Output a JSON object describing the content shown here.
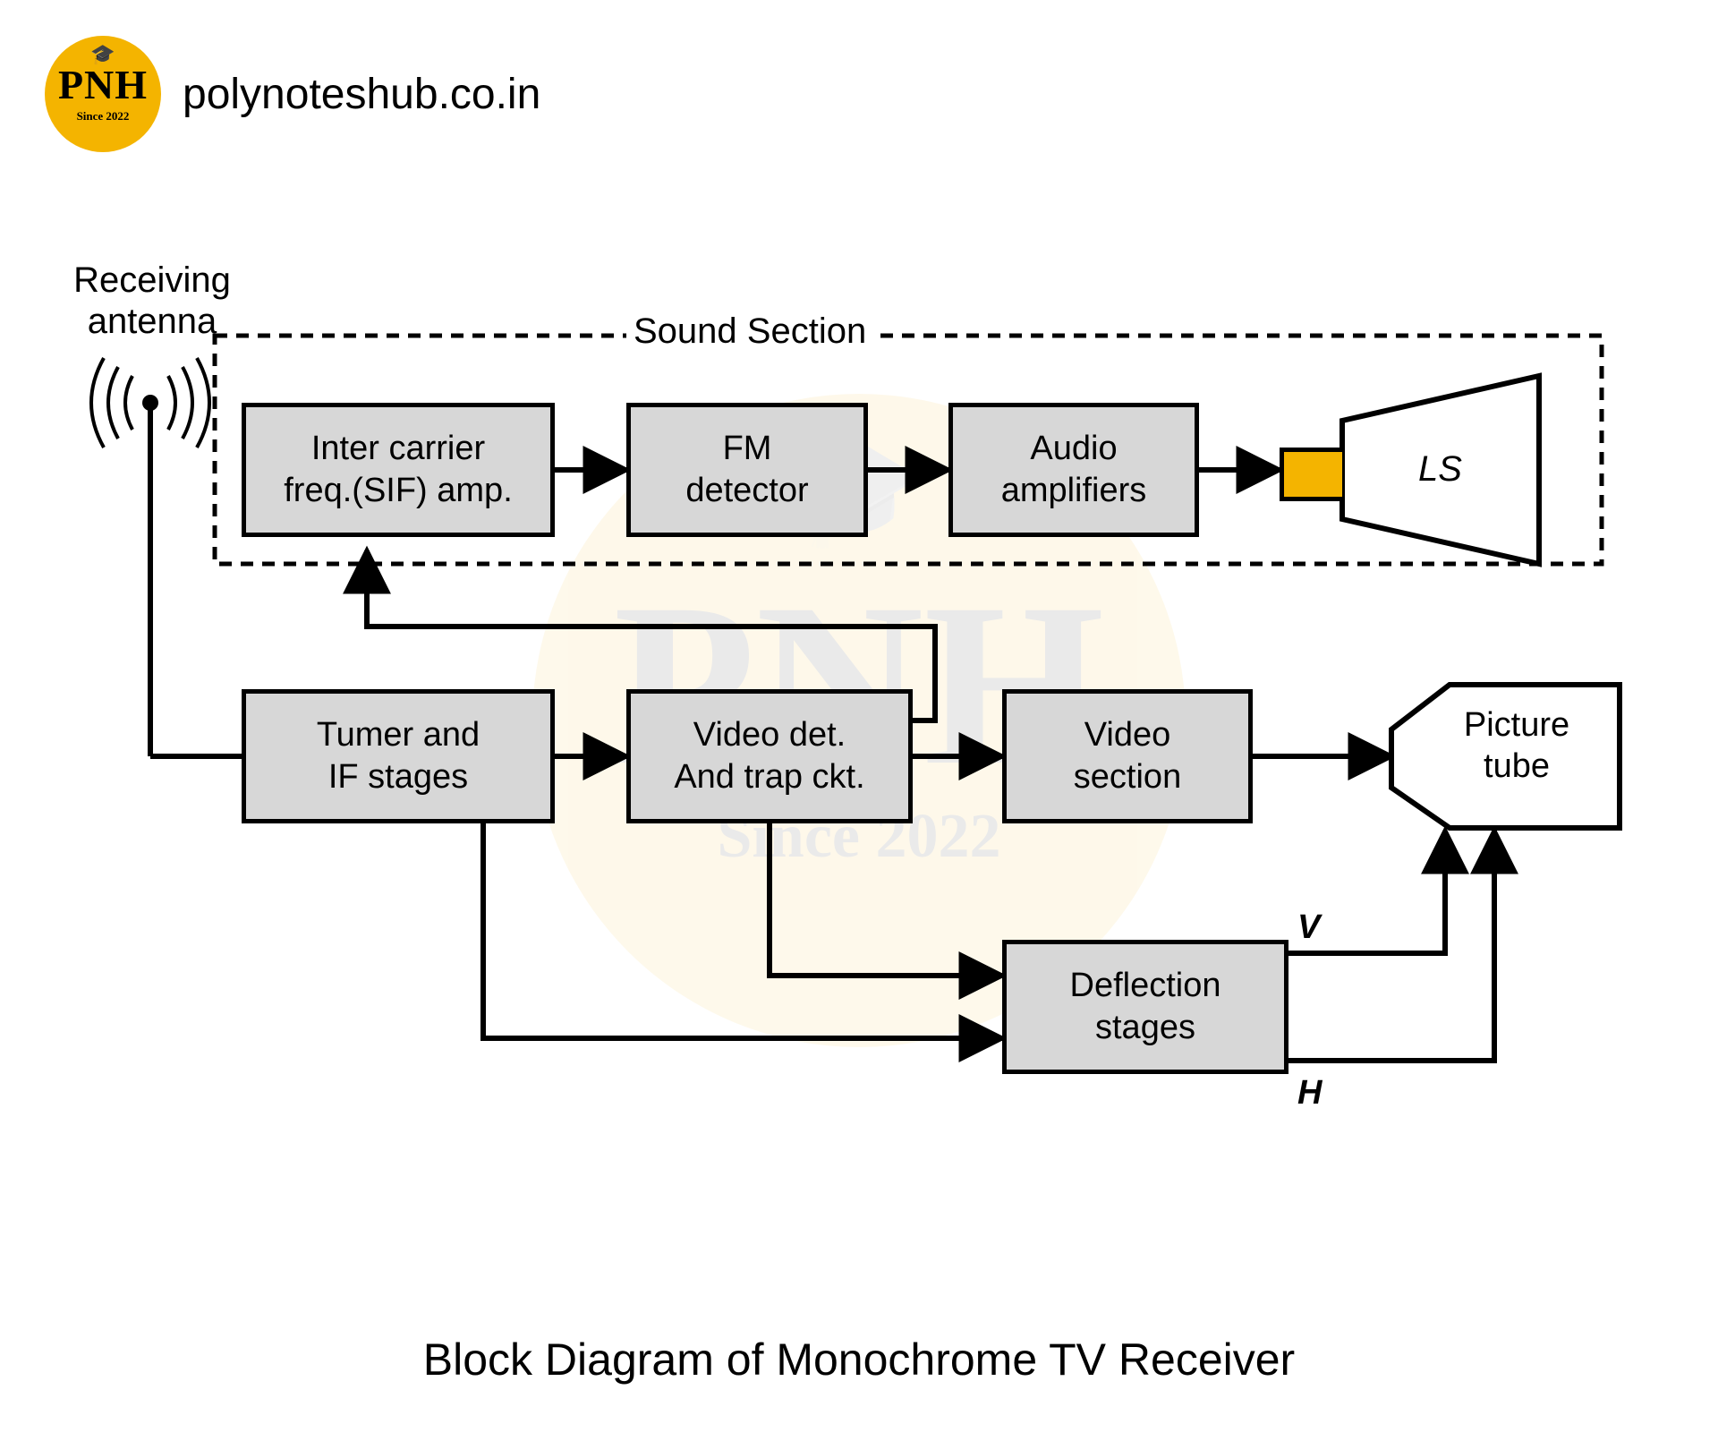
{
  "site": {
    "url": "polynoteshub.co.in",
    "logo": {
      "main": "PNH",
      "since": "Since 2022",
      "cap_icon_name": "graduation-cap-icon"
    }
  },
  "caption": "Block Diagram of Monochrome TV Receiver",
  "diagram": {
    "antenna_label": "Receiving\nantenna",
    "sound_section_label": "Sound Section",
    "blocks": {
      "sif": "Inter carrier\nfreq.(SIF) amp.",
      "fm": "FM\ndetector",
      "audio": "Audio\namplifiers",
      "tuner": "Tumer and\nIF stages",
      "videodet": "Video det.\nAnd trap ckt.",
      "videosec": "Video\nsection",
      "deflection": "Deflection\nstages",
      "ls": "LS",
      "picture": "Picture\ntube"
    },
    "deflection_outputs": {
      "v": "V",
      "h": "H"
    }
  }
}
